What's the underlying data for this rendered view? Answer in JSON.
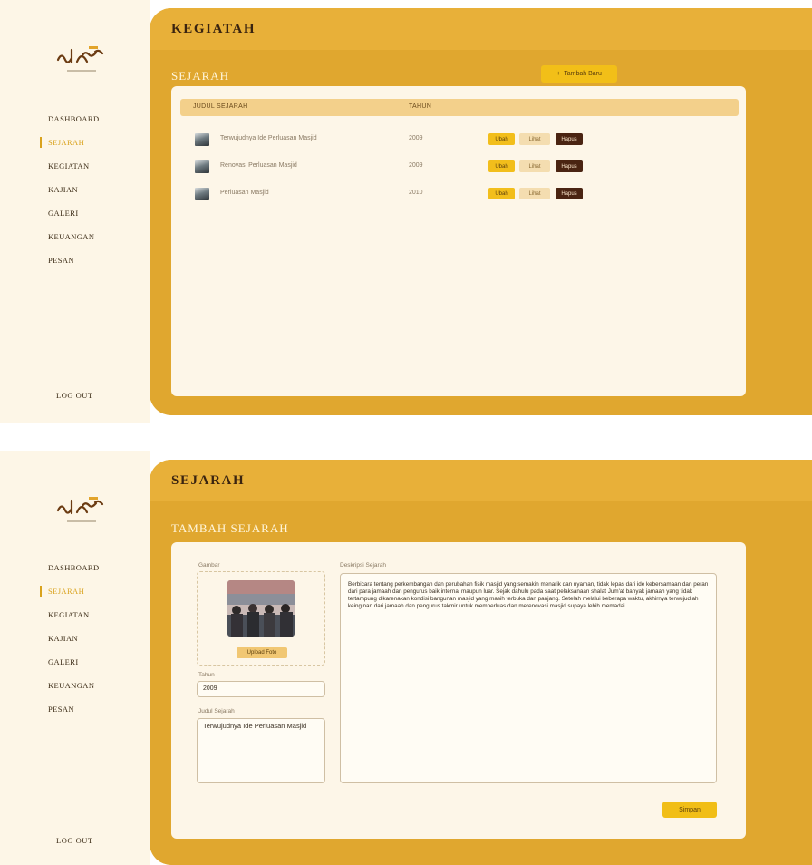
{
  "colors": {
    "accent": "#e0a72f",
    "accent_light": "#e8b039",
    "sidebar_bg": "#fdf6e7",
    "card_bg": "#fdf6e8",
    "button_yellow": "#f2be1b",
    "button_dark": "#4a2412",
    "active_nav": "#d9a21d"
  },
  "nav": {
    "items": [
      "DASHBOARD",
      "SEJARAH",
      "KEGIATAN",
      "KAJIAN",
      "GALERI",
      "KEUANGAN",
      "PESAN"
    ],
    "active": "SEJARAH",
    "logout": "LOG OUT"
  },
  "screen1": {
    "header_title": "KEGIATAH",
    "section_title": "SEJARAH",
    "add_button": "Tambah Baru",
    "table": {
      "columns": [
        "JUDUL SEJARAH",
        "TAHUN"
      ],
      "rows": [
        {
          "title": "Terwujudnya Ide Perluasan Masjid",
          "year": "2009"
        },
        {
          "title": "Renovasi Perluasan Masjid",
          "year": "2009"
        },
        {
          "title": "Perluasan Masjid",
          "year": "2010"
        }
      ],
      "actions": {
        "edit": "Ubah",
        "view": "Lihat",
        "delete": "Hapus"
      }
    }
  },
  "screen2": {
    "header_title": "SEJARAH",
    "section_title": "TAMBAH SEJARAH",
    "photo_label": "Gambar",
    "upload_button": "Upload Foto",
    "year_label": "Tahun",
    "year_value": "2009",
    "judul_label": "Judul Sejarah",
    "judul_value": "Terwujudnya Ide Perluasan Masjid",
    "desc_label": "Deskripsi Sejarah",
    "desc_value": "Berbicara tentang perkembangan dan perubahan fisik masjid yang semakin menarik dan nyaman, tidak lepas dari ide kebersamaan dan peran dari para jamaah dan pengurus baik internal maupun luar. Sejak dahulu pada saat pelaksanaan shalat Jum'at banyak jamaah yang tidak tertampung dikarenakan kondisi bangunan masjid yang masih terbuka dan panjang. Setelah melalui beberapa waktu, akhirnya terwujudlah keinginan dari jamaah dan pengurus takmir untuk memperluas dan merenovasi masjid supaya lebih memadai.",
    "save_button": "Simpan"
  }
}
